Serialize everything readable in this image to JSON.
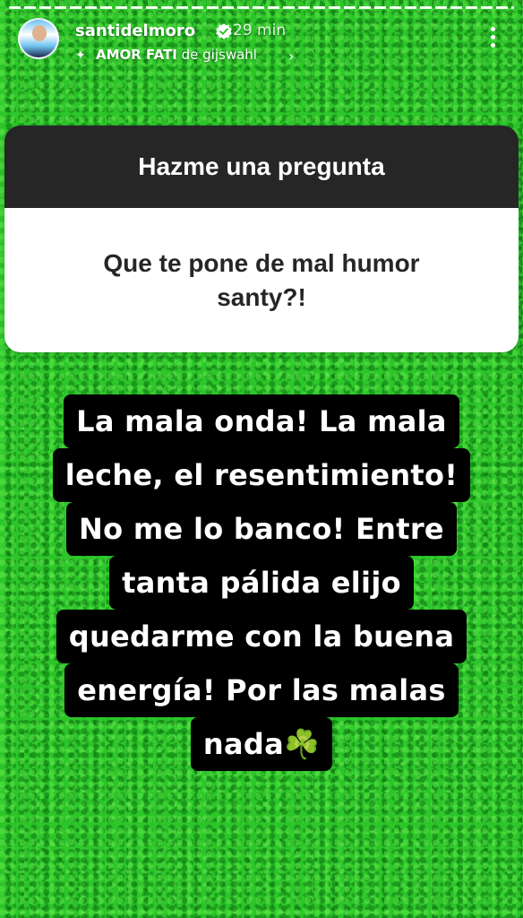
{
  "header": {
    "username": "santidelmoro",
    "time": "29 min",
    "music": {
      "song": "AMOR FATI",
      "by": "de",
      "artist": "gijswahl"
    }
  },
  "question": {
    "title": "Hazme una pregunta",
    "text": "Que te pone de mal humor santy?!"
  },
  "answer": {
    "lines": [
      "La mala onda! La mala",
      "leche, el resentimiento!",
      "No me lo banco! Entre",
      "tanta pálida elijo",
      "quedarme con la buena",
      "energía! Por las malas",
      "nada☘️"
    ]
  },
  "colors": {
    "background": "#2cc52a",
    "card_header": "#262626",
    "card_body": "#ffffff",
    "answer_bg": "#000000",
    "verified": "#ffffff"
  },
  "icons": [
    "verified-badge-icon",
    "music-sparkle-icon",
    "chevron-right-icon",
    "more-options-icon",
    "shamrock-emoji"
  ]
}
